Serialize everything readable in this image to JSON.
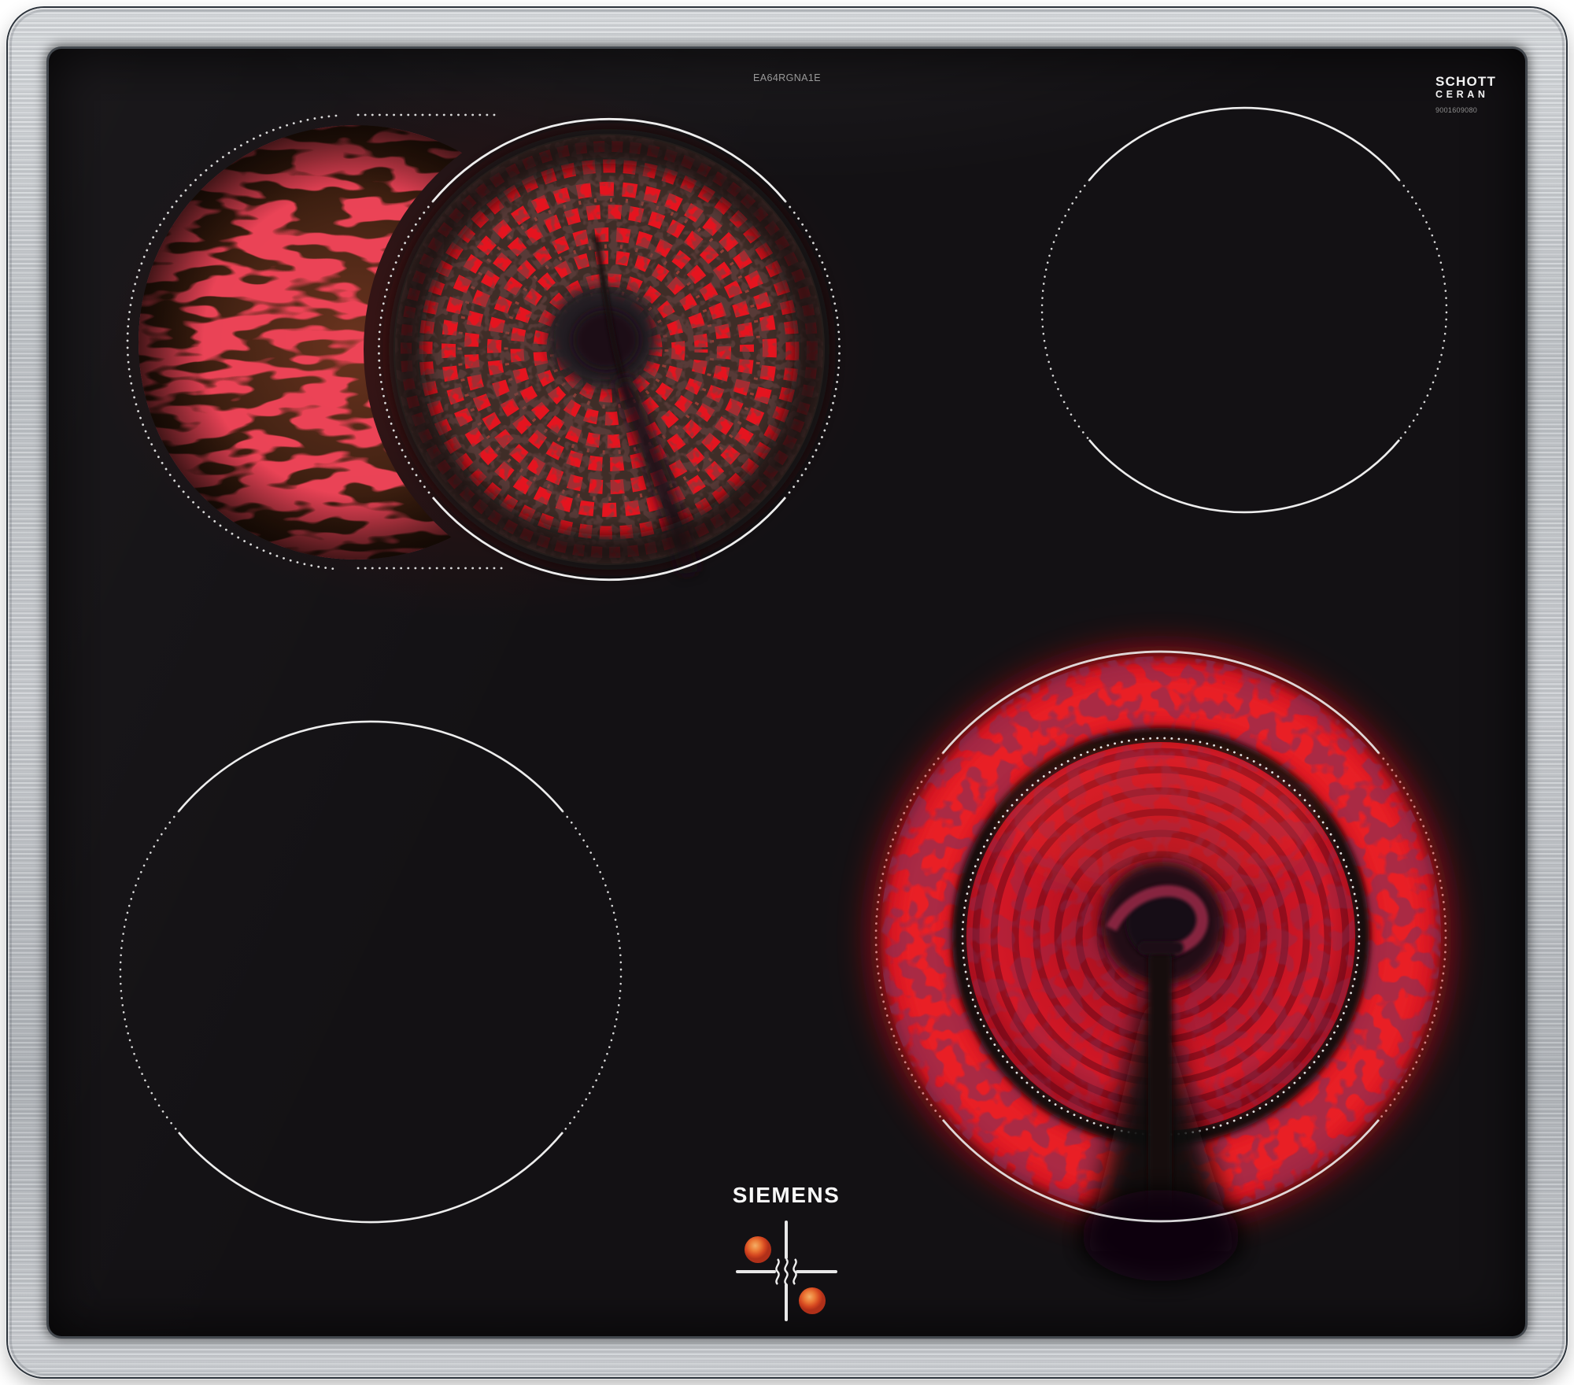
{
  "product": {
    "brand": "SIEMENS",
    "model_label": "EA64RGNA1E"
  },
  "glass_badge": {
    "maker": "SCHOTT",
    "line": "CERAN",
    "serial": "9001609080"
  },
  "zones": [
    {
      "name": "rear-left-dual-zone",
      "state": "on",
      "appearance": "extendable roaster zone, outer crescent and main coil glowing red"
    },
    {
      "name": "rear-right-zone",
      "state": "off",
      "appearance": "outlined circle only"
    },
    {
      "name": "front-left-zone",
      "state": "off",
      "appearance": "outlined circle only"
    },
    {
      "name": "front-right-zone",
      "state": "on",
      "appearance": "large radiant zone glowing red with dark sensor shadow"
    }
  ],
  "indicator": {
    "icon": "residual-heat-waves-icon",
    "hot_zone_dots": 2
  },
  "colors": {
    "glass": "#131114",
    "frame_steel": "#c9cdd1",
    "glow_red": "#d81420",
    "coil_red": "#e81626",
    "outline_white": "#ededed",
    "indicator_dot": "#e06a2e"
  }
}
